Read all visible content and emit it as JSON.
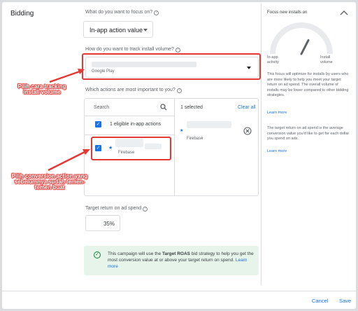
{
  "section_title": "Bidding",
  "focus": {
    "question": "What do you want to focus on?",
    "value": "In-app action value"
  },
  "install_volume": {
    "question": "How do you want to track install volume?",
    "source": "Google Play"
  },
  "actions": {
    "question": "Which actions are most important to you?",
    "search_placeholder": "Search",
    "eligible_label": "1 eligible in-app actions",
    "available": [
      {
        "source": "Firebase"
      }
    ],
    "selected_count_label": "1 selected",
    "clear_all": "Clear all",
    "selected": [
      {
        "source": "Firebase"
      }
    ]
  },
  "target_roas": {
    "label": "Target return on ad spend",
    "value": "35%"
  },
  "info": {
    "text_before": "This campaign will use the ",
    "strategy": "Target ROAS",
    "text_after": " bid strategy to help you get the most conversion value at or above your target return on spend.",
    "learn_more": "Learn more"
  },
  "side_card": {
    "title": "Focus new installs on",
    "gauge_left": [
      "In-app",
      "activity"
    ],
    "gauge_right": [
      "Install",
      "volume"
    ],
    "gauge_level": 0.65,
    "para1": "This focus will optimize for installs by users who are more likely to help you meet your target return on ad spend. The overall volume of installs may be lower compared to other bidding strategies.",
    "learn_more": "Learn more",
    "para2": "The target return on ad spend is the average conversion value you'd like to get for each dollar you spend on ads."
  },
  "annotations": {
    "install_volume": [
      "Pilih cara tracking",
      "install volume"
    ],
    "conversion_action": [
      "Pilih conversion action yang",
      "sebelumnya sudah temen-",
      "temen buat"
    ]
  },
  "footer": {
    "cancel": "Cancel",
    "save": "Save"
  },
  "colors": {
    "accent": "#1a73e8",
    "highlight": "#e53935",
    "success_bg": "#e6f4ea"
  }
}
